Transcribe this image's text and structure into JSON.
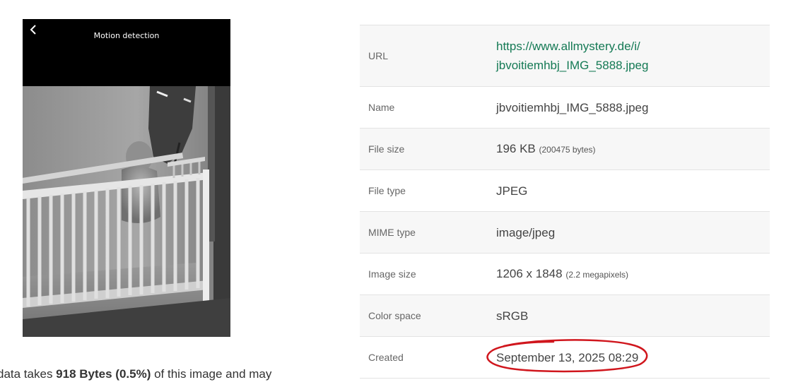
{
  "phone_preview": {
    "title": "Motion detection",
    "back_icon": "chevron-left-icon"
  },
  "metadata_note": {
    "prefix": "data takes ",
    "bold": "918 Bytes (0.5%)",
    "suffix": " of this image and may"
  },
  "details": {
    "url": {
      "label": "URL",
      "value_line1": "https://www.allmystery.de/i/",
      "value_line2": "jbvoitiemhbj_IMG_5888.jpeg"
    },
    "name": {
      "label": "Name",
      "value": "jbvoitiemhbj_IMG_5888.jpeg"
    },
    "file_size": {
      "label": "File size",
      "value": "196 KB",
      "detail": "(200475 bytes)"
    },
    "file_type": {
      "label": "File type",
      "value": "JPEG"
    },
    "mime_type": {
      "label": "MIME type",
      "value": "image/jpeg"
    },
    "image_size": {
      "label": "Image size",
      "value": "1206 x 1848",
      "detail": "(2.2 megapixels)"
    },
    "color_space": {
      "label": "Color space",
      "value": "sRGB"
    },
    "created": {
      "label": "Created",
      "value": "September 13, 2025 08:29"
    }
  },
  "colors": {
    "link": "#157a55",
    "annotation_circle": "#d0161d",
    "row_shade": "#f7f7f7"
  }
}
